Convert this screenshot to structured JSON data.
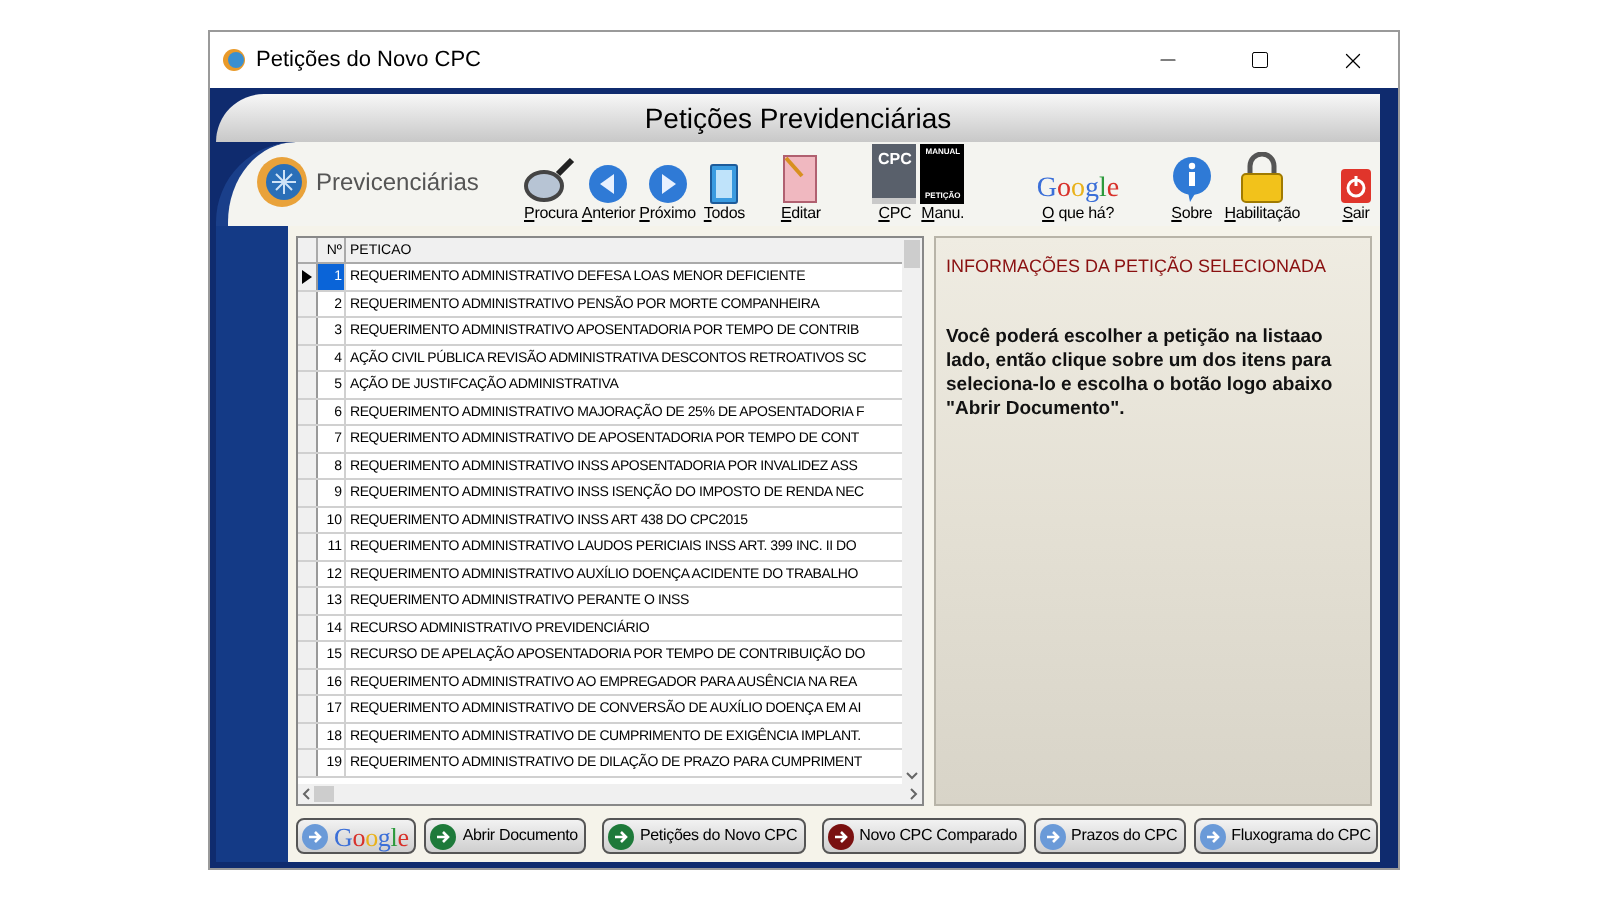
{
  "window": {
    "title": "Petições do Novo CPC"
  },
  "header": {
    "title": "Petições Previdenciárias"
  },
  "logo": {
    "text": "Previcenciárias"
  },
  "toolbar": [
    {
      "kind": "search",
      "label": "Procura"
    },
    {
      "kind": "prev",
      "label": "Anterior"
    },
    {
      "kind": "next",
      "label": "Próximo"
    },
    {
      "kind": "all",
      "label": "Todos"
    },
    {
      "kind": "edit",
      "label": "Editar"
    },
    {
      "kind": "cpc",
      "label": "CPC",
      "icon_text": [
        "CPC"
      ]
    },
    {
      "kind": "manual",
      "label": "Manu.",
      "icon_text": [
        "MANUAL",
        "PETIÇÃO"
      ]
    },
    {
      "kind": "google",
      "label": "O que há?",
      "icon_text": [
        "Google"
      ]
    },
    {
      "kind": "about",
      "label": "Sobre"
    },
    {
      "kind": "lock",
      "label": "Habilitação"
    },
    {
      "kind": "exit",
      "label": "Sair"
    }
  ],
  "table": {
    "columns": [
      "Nº",
      "PETICAO"
    ],
    "rows": [
      {
        "num": "1",
        "text": "REQUERIMENTO ADMINISTRATIVO DEFESA LOAS MENOR DEFICIENTE",
        "selected": true
      },
      {
        "num": "2",
        "text": "REQUERIMENTO ADMINISTRATIVO PENSÃO POR MORTE COMPANHEIRA",
        "selected": false
      },
      {
        "num": "3",
        "text": "REQUERIMENTO ADMINISTRATIVO APOSENTADORIA POR TEMPO DE CONTRIB",
        "selected": false
      },
      {
        "num": "4",
        "text": "AÇÃO CIVIL PÚBLICA REVISÃO ADMINISTRATIVA DESCONTOS RETROATIVOS SC",
        "selected": false
      },
      {
        "num": "5",
        "text": "AÇÃO DE JUSTIFCAÇÃO ADMINISTRATIVA",
        "selected": false
      },
      {
        "num": "6",
        "text": "REQUERIMENTO ADMINISTRATIVO MAJORAÇÃO DE 25% DE APOSENTADORIA F",
        "selected": false
      },
      {
        "num": "7",
        "text": "REQUERIMENTO ADMINISTRATIVO DE APOSENTADORIA POR TEMPO DE CONT",
        "selected": false
      },
      {
        "num": "8",
        "text": "REQUERIMENTO ADMINISTRATIVO INSS APOSENTADORIA POR INVALIDEZ ASS",
        "selected": false
      },
      {
        "num": "9",
        "text": "REQUERIMENTO ADMINISTRATIVO INSS ISENÇÃO DO IMPOSTO DE RENDA NEC",
        "selected": false
      },
      {
        "num": "10",
        "text": "REQUERIMENTO ADMINISTRATIVO INSS ART 438 DO CPC2015",
        "selected": false
      },
      {
        "num": "11",
        "text": "REQUERIMENTO ADMINISTRATIVO LAUDOS PERICIAIS INSS ART. 399 INC. II DO",
        "selected": false
      },
      {
        "num": "12",
        "text": "REQUERIMENTO ADMINISTRATIVO AUXÍLIO DOENÇA ACIDENTE DO TRABALHO",
        "selected": false
      },
      {
        "num": "13",
        "text": "REQUERIMENTO ADMINISTRATIVO PERANTE O INSS",
        "selected": false
      },
      {
        "num": "14",
        "text": "RECURSO ADMINISTRATIVO PREVIDENCIÁRIO",
        "selected": false
      },
      {
        "num": "15",
        "text": "RECURSO DE APELAÇÃO APOSENTADORIA POR TEMPO DE CONTRIBUIÇÃO DO",
        "selected": false
      },
      {
        "num": "16",
        "text": "REQUERIMENTO ADMINISTRATIVO AO EMPREGADOR PARA AUSÊNCIA NA REA",
        "selected": false
      },
      {
        "num": "17",
        "text": "REQUERIMENTO ADMINISTRATIVO DE CONVERSÃO DE AUXÍLIO DOENÇA EM AI",
        "selected": false
      },
      {
        "num": "18",
        "text": "REQUERIMENTO ADMINISTRATIVO DE CUMPRIMENTO DE EXIGÊNCIA IMPLANT.",
        "selected": false
      },
      {
        "num": "19",
        "text": "REQUERIMENTO ADMINISTRATIVO DE DILAÇÃO DE PRAZO PARA CUMPRIMENT",
        "selected": false
      }
    ]
  },
  "info": {
    "title": "INFORMAÇÕES DA PETIÇÃO SELECIONADA",
    "text": "Você poderá escolher a petição na listaao lado, então clique sobre um dos itens para seleciona-lo e escolha o botão logo abaixo \"Abrir Documento\"."
  },
  "buttons": [
    {
      "kind": "google",
      "label": "Google",
      "color": "#6a9ad8"
    },
    {
      "kind": "plain",
      "label": "Abrir Documento",
      "color": "#1e7a3a"
    },
    {
      "kind": "plain",
      "label": "Petições do Novo CPC",
      "color": "#1e7a3a"
    },
    {
      "kind": "plain",
      "label": "Novo CPC Comparado",
      "color": "#7a1010"
    },
    {
      "kind": "plain",
      "label": "Prazos do CPC",
      "color": "#6a9ad8"
    },
    {
      "kind": "plain",
      "label": "Fluxograma do CPC",
      "color": "#6a9ad8"
    }
  ]
}
